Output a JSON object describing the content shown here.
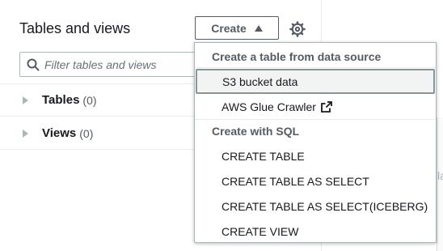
{
  "panel": {
    "title": "Tables and views",
    "create_label": "Create",
    "search_placeholder": "Filter tables and views",
    "tree": [
      {
        "label": "Tables",
        "count": "(0)"
      },
      {
        "label": "Views",
        "count": "(0)"
      }
    ]
  },
  "right_fragment": "la",
  "dropdown": {
    "group1_header": "Create a table from data source",
    "group1_items": [
      "S3 bucket data",
      "AWS Glue Crawler"
    ],
    "group2_header": "Create with SQL",
    "group2_items": [
      "CREATE TABLE",
      "CREATE TABLE AS SELECT",
      "CREATE TABLE AS SELECT(ICEBERG)",
      "CREATE VIEW"
    ]
  },
  "colors": {
    "text": "#16191f",
    "secondary": "#545b64",
    "border": "#aab7b8"
  },
  "icons": [
    "caret-up-icon",
    "gear-icon",
    "search-icon",
    "expand-triangle-icon",
    "external-link-icon"
  ]
}
